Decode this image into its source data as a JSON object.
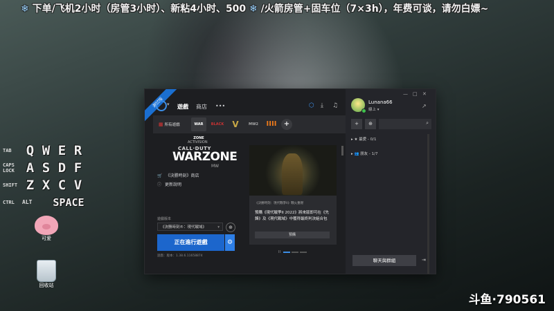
{
  "banner": {
    "text": "下单/飞机2小时（房管3小时）、新粘4小时、500",
    "text2": "/火箭房管+固车位（7×3h），年费可谈，请勿白嫖~"
  },
  "keyboard": {
    "row1": {
      "mod": "TAB",
      "keys": [
        "Q",
        "W",
        "E",
        "R"
      ]
    },
    "row2": {
      "mod": "CAPS LOCK",
      "keys": [
        "A",
        "S",
        "D",
        "F"
      ]
    },
    "row3": {
      "mod": "SHIFT",
      "keys": [
        "Z",
        "X",
        "C",
        "V"
      ]
    },
    "row4": {
      "mod": "CTRL",
      "mod2": "ALT",
      "space": "SPACE"
    }
  },
  "desktop": {
    "icon1": "可爱",
    "icon2": "回收站"
  },
  "watermark": "斗鱼·790561",
  "app": {
    "ribbon": "測試版",
    "nav": {
      "games": "遊戲",
      "shop": "商店",
      "more": "•••"
    },
    "tabs": {
      "all": "所有遊戲",
      "warzone": "WAR ZONE",
      "black": "BLACK",
      "vg": "V",
      "mw2": "MW2",
      "bo": "IIII",
      "plus": "+"
    },
    "game": {
      "publisher": "ACTIVISION",
      "brand_small": "CALL·DUTY",
      "brand": "WARZONE",
      "brand_sub": "MW",
      "shop_link": "《決勝時刻》商店",
      "patch_notes": "更新說明",
      "version_label": "遊戲版本",
      "version_select": "《決勝時刻®：現代戰域》",
      "play_button": "正在進行遊戲",
      "version_info": "遊戲：版本：1.38.6.11658874"
    },
    "card": {
      "tag": "《決勝時刻：現代戰爭II》戰火重燃",
      "text": "預購《現代戰爭II 2022》將來版即可在《先鋒》及《現代戰域》中獲得最終判決組合包",
      "button": "預購"
    },
    "pager": "II"
  },
  "friends": {
    "window_controls": [
      "—",
      "□",
      "✕"
    ],
    "username": "Lunana66",
    "status": "線上 ▾",
    "groups": [
      {
        "label": "▸ ★ 最愛 - 0/1"
      },
      {
        "label": "▸ 👥 朋友 - 1/7"
      }
    ],
    "chat_button": "聊天與群組",
    "logout_icon": "⇥"
  },
  "colors": {
    "accent": "#1c66cc",
    "online": "#3ec24d",
    "banner_flake": "#9ad4ff"
  }
}
